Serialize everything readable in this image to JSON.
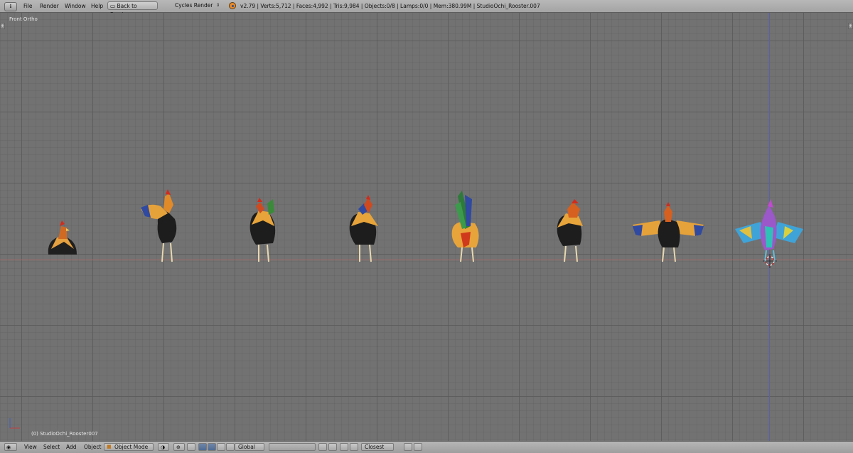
{
  "menu": {
    "editor_type_icon": "info-icon",
    "items": [
      "File",
      "Render",
      "Window",
      "Help"
    ],
    "back_button": "Back to Previous",
    "renderer": "Cycles Render",
    "status": "v2.79 | Verts:5,712 | Faces:4,992 | Tris:9,984 | Objects:0/8 | Lamps:0/0 | Mem:380.99M | StudioOchi_Rooster.007"
  },
  "viewport": {
    "view_label": "Front Ortho",
    "object_label": "(0) StudioOchi_Rooster007",
    "colors": {
      "background": "#727272",
      "x_axis": "#a06868",
      "z_axis": "#5d5fa8"
    },
    "models": [
      {
        "name": "rooster-sitting",
        "pose": "sitting"
      },
      {
        "name": "rooster-crowing",
        "pose": "crowing"
      },
      {
        "name": "rooster-facing-front",
        "pose": "standing"
      },
      {
        "name": "rooster-standing-side",
        "pose": "standing"
      },
      {
        "name": "rooster-rear-tail",
        "pose": "rear"
      },
      {
        "name": "rooster-turned",
        "pose": "standing"
      },
      {
        "name": "rooster-wings-spread",
        "pose": "wings"
      },
      {
        "name": "rooster-uv-colored",
        "pose": "uv-wings"
      }
    ]
  },
  "footer": {
    "view": "View",
    "select": "Select",
    "add": "Add",
    "object": "Object",
    "mode": "Object Mode",
    "orientation": "Global",
    "snap": "Closest"
  }
}
